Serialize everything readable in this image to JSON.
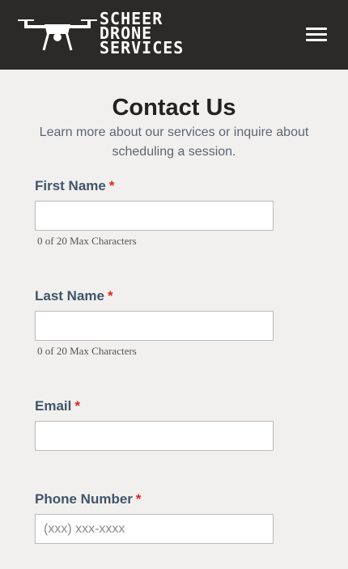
{
  "header": {
    "brand_line1": "SCHEER",
    "brand_line2": "DRONE",
    "brand_line3": "SERVICES",
    "menu_icon": "hamburger-menu-icon"
  },
  "page": {
    "title": "Contact Us",
    "subtitle": "Learn more about our services or inquire about scheduling a session."
  },
  "form": {
    "required_marker": "*",
    "first_name": {
      "label": "First Name",
      "value": "",
      "hint": "0 of 20 Max Characters"
    },
    "last_name": {
      "label": "Last Name",
      "value": "",
      "hint": "0 of 20 Max Characters"
    },
    "email": {
      "label": "Email",
      "value": ""
    },
    "phone": {
      "label": "Phone Number",
      "value": "",
      "placeholder": "(xxx) xxx-xxxx"
    }
  },
  "colors": {
    "header_bg": "#2b2a29",
    "page_bg": "#f2f0ee",
    "label": "#40556b",
    "required": "#e02424"
  }
}
